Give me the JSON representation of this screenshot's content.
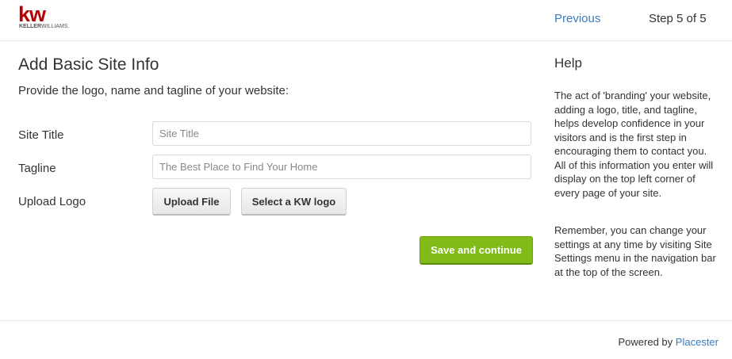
{
  "header": {
    "logo_mark": "kw",
    "logo_sub_bold": "KELLER",
    "logo_sub_rest": "WILLIAMS.",
    "previous_label": "Previous",
    "step_label": "Step 5 of 5"
  },
  "form": {
    "title": "Add Basic Site Info",
    "description": "Provide the logo, name and tagline of your website:",
    "site_title_label": "Site Title",
    "site_title_placeholder": "Site Title",
    "tagline_label": "Tagline",
    "tagline_placeholder": "The Best Place to Find Your Home",
    "upload_logo_label": "Upload Logo",
    "upload_file_button": "Upload File",
    "select_kw_logo_button": "Select a KW logo",
    "save_button": "Save and continue"
  },
  "help": {
    "title": "Help",
    "paragraph1": "The act of 'branding' your website, adding a logo, title, and tagline, helps develop confidence in your visitors and is the first step in encouraging them to contact you. All of this information you enter will display on the top left corner of every page of your site.",
    "paragraph2": "Remember, you can change your settings at any time by visiting Site Settings menu in the navigation bar at the top of the screen."
  },
  "footer": {
    "powered_by": "Powered by",
    "brand_link": "Placester"
  },
  "colors": {
    "brand_red": "#b40101",
    "link_blue": "#3a7bbf",
    "save_green": "#80bb17"
  }
}
